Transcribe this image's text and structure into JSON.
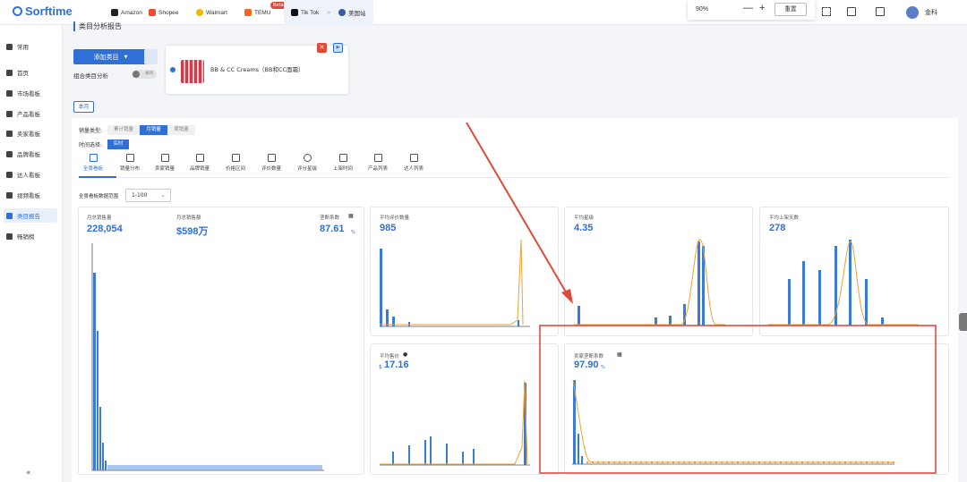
{
  "topbar": {
    "logo": "Sorftime",
    "platforms": [
      {
        "label": "Amazon",
        "color": "#222"
      },
      {
        "label": "Shopee",
        "color": "#ee4d2d"
      },
      {
        "label": "Walmart",
        "color": "#f5b800"
      },
      {
        "label": "TEMU",
        "color": "#f06a1d"
      },
      {
        "label": "Tik Tok",
        "color": "#111"
      }
    ],
    "beta": "Beta",
    "breadcrumb_sep": ">",
    "site": "美国站",
    "zoom": "90%",
    "zoom_minus": "—",
    "zoom_plus": "+",
    "reset": "重置",
    "user": "金科"
  },
  "sidebar": {
    "items": [
      {
        "label": "常用",
        "icon": "shield-icon"
      },
      {
        "label": "首页",
        "icon": "home-icon"
      },
      {
        "label": "市场看板",
        "icon": "market-icon"
      },
      {
        "label": "产品看板",
        "icon": "product-icon"
      },
      {
        "label": "卖家看板",
        "icon": "seller-icon"
      },
      {
        "label": "品牌看板",
        "icon": "brand-icon"
      },
      {
        "label": "达人看板",
        "icon": "influencer-icon"
      },
      {
        "label": "视频看板",
        "icon": "video-icon"
      },
      {
        "label": "类目报告",
        "icon": "report-icon"
      },
      {
        "label": "畅销榜",
        "icon": "bestseller-icon"
      }
    ],
    "active": 8,
    "collapse": "«"
  },
  "section_title": "类目分析报告",
  "add_category": "添加类目",
  "combo_label": "组合类目分析",
  "toggle_label": "关闭",
  "category": {
    "name": "BB & CC Creams（BB和CC面霜）"
  },
  "month_tag": "本月",
  "sales_type": {
    "label": "销量类型:",
    "options": [
      "累计销量",
      "月销量",
      "周销量"
    ],
    "active": 1
  },
  "time_select": {
    "label": "时间选择:",
    "value": "实时"
  },
  "nav_tabs": [
    "全景看板",
    "销量分布",
    "卖家销量",
    "品牌销量",
    "价格区间",
    "评价数量",
    "评分星级",
    "上架时间",
    "产品列表",
    "达人列表"
  ],
  "range": {
    "label": "全景看板数据范围",
    "value": "1-100"
  },
  "metrics": {
    "monthly_sales_label": "月总销售量",
    "monthly_sales": "228,054",
    "monthly_revenue_label": "月总销售额",
    "monthly_revenue": "$598万",
    "monopoly_label": "垄断系数",
    "monopoly": "87.61",
    "pct": "%",
    "avg_reviews_label": "平均评价数量",
    "avg_reviews": "985",
    "avg_rating_label": "平均星级",
    "avg_rating": "4.35",
    "avg_days_label": "平均上架天数",
    "avg_days": "278",
    "avg_price_label": "平均售价",
    "currency": "$",
    "avg_price": "17.16",
    "seller_mono_label": "卖家垄断系数",
    "seller_mono": "97.90"
  },
  "colors": {
    "accent": "#2f6fd6",
    "bar": "#3a7bd5",
    "line": "#f0a032",
    "highlight": "#e04a3b"
  }
}
